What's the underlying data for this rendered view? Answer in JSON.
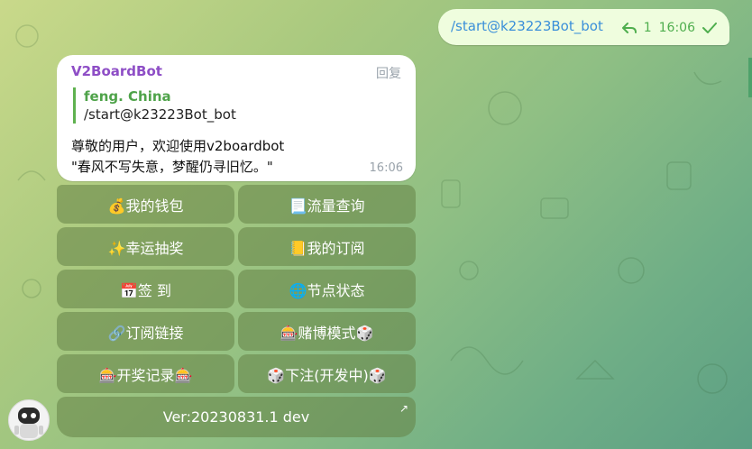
{
  "outgoing": {
    "text": "/start@k23223Bot_bot",
    "reply_count": "1",
    "time": "16:06"
  },
  "incoming": {
    "sender": "V2BoardBot",
    "reply_label": "回复",
    "quote_name": "feng. China",
    "quote_text": "/start@k23223Bot_bot",
    "line1": "尊敬的用户，欢迎使用v2boardbot",
    "line2": "\"春风不写失意，梦醒仍寻旧忆。\"",
    "time": "16:06"
  },
  "keyboard": {
    "rows": [
      [
        "💰我的钱包",
        "📃流量查询"
      ],
      [
        "✨幸运抽奖",
        "📒我的订阅"
      ],
      [
        "📅签 到",
        "🌐节点状态"
      ],
      [
        "🔗订阅链接",
        "🎰赌博模式🎲"
      ],
      [
        "🎰开奖记录🎰",
        "🎲下注(开发中)🎲"
      ]
    ],
    "version": "Ver:20230831.1 dev"
  },
  "colors": {
    "sender": "#8e4ec6",
    "link": "#3a8fd9",
    "check": "#4fae4e"
  }
}
